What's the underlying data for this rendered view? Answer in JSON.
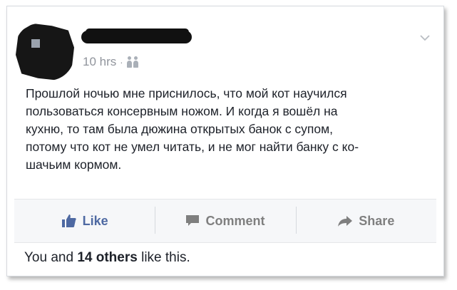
{
  "post": {
    "timestamp": "10 hrs",
    "separator": "·",
    "text": "Прошлой ночью мне приснилось, что мой кот научился\nпользоваться консервным ножом. И когда я вошёл на\nкухню, то там была дюжина открытых банок с супом,\nпотому что кот не умел читать, и не мог найти банку с ко-\nшачьим кормом."
  },
  "actions": {
    "like_label": "Like",
    "comment_label": "Comment",
    "share_label": "Share"
  },
  "likes": {
    "prefix": "You and ",
    "count_text": "14 others",
    "suffix": " like this."
  },
  "colors": {
    "like_blue": "#4e69a2",
    "muted_gray": "#7f7f7f",
    "action_bar_bg": "#f6f7f9"
  },
  "icons": [
    "avatar-redacted",
    "audience-friends-icon",
    "chevron-down-icon",
    "thumbs-up-icon",
    "comment-icon",
    "share-icon"
  ]
}
